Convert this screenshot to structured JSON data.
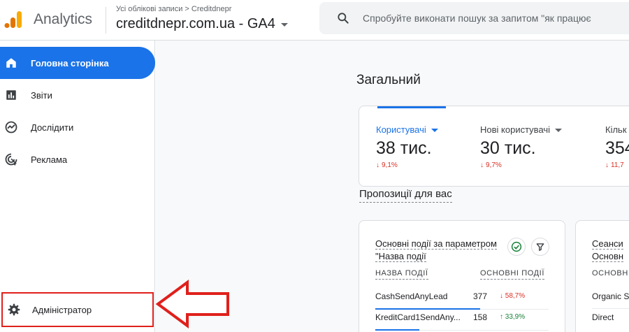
{
  "header": {
    "product_name": "Analytics",
    "breadcrumb": "Усі облікові записи > Creditdnepr",
    "property": "creditdnepr.com.ua - GA4",
    "search_placeholder": "Спробуйте виконати пошук за запитом \"як працює"
  },
  "sidebar": {
    "items": [
      {
        "label": "Головна сторінка",
        "icon": "home-icon",
        "active": true
      },
      {
        "label": "Звіти",
        "icon": "reports-icon",
        "active": false
      },
      {
        "label": "Дослідити",
        "icon": "explore-icon",
        "active": false
      },
      {
        "label": "Реклама",
        "icon": "advertising-icon",
        "active": false
      }
    ],
    "admin_label": "Адміністратор"
  },
  "main": {
    "section_title": "Загальний",
    "metrics": [
      {
        "label": "Користувачі",
        "value": "38 тис.",
        "delta": "9,1%",
        "direction": "down"
      },
      {
        "label": "Нові користувачі",
        "value": "30 тис.",
        "delta": "9,7%",
        "direction": "down"
      },
      {
        "label": "Кільк",
        "value": "354",
        "delta": "11,7",
        "direction": "down"
      }
    ],
    "suggestions_title": "Пропозиції для вас",
    "card1": {
      "title": "Основні події за параметром \"Назва події",
      "col_name": "НАЗВА ПОДІЇ",
      "col_value": "ОСНОВНІ ПОДІЇ",
      "rows": [
        {
          "name": "CashSendAnyLead",
          "value": "377",
          "delta": "58,7%",
          "direction": "down",
          "bar": 1.0
        },
        {
          "name": "KreditCard1SendAny...",
          "value": "158",
          "delta": "33,9%",
          "direction": "up",
          "bar": 0.42
        }
      ]
    },
    "card2": {
      "title_line1": "Сеанси",
      "title_line2": "Основн",
      "col": "ОСНОВН",
      "rows": [
        "Organic S",
        "Direct"
      ]
    }
  },
  "colors": {
    "accent": "#1a73e8",
    "negative": "#d93025",
    "positive": "#188038",
    "annotation": "#e0201c",
    "logo_orange": "#f9ab00",
    "logo_dark_orange": "#e37400"
  }
}
